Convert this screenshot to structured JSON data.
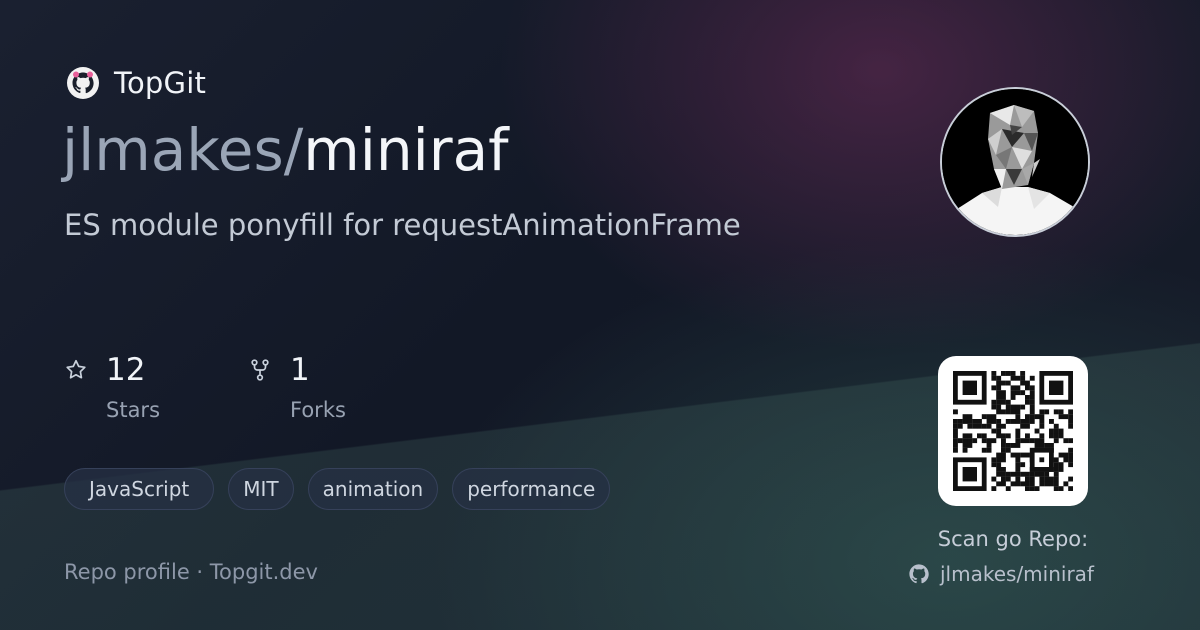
{
  "brand": {
    "name": "TopGit",
    "logo_icon": "github-octocat-icon"
  },
  "repo": {
    "owner": "jlmakes",
    "separator": "/",
    "name": "miniraf",
    "description": "ES module ponyfill for requestAnimationFrame"
  },
  "stats": [
    {
      "icon": "star-icon",
      "value": "12",
      "label": "Stars"
    },
    {
      "icon": "fork-icon",
      "value": "1",
      "label": "Forks"
    }
  ],
  "tags": [
    "JavaScript",
    "MIT",
    "animation",
    "performance"
  ],
  "footer": {
    "text": "Repo profile · Topgit.dev"
  },
  "qr": {
    "caption": "Scan go Repo:",
    "repo_link": "jlmakes/miniraf",
    "link_icon": "github-icon"
  },
  "colors": {
    "background": "#141a27",
    "accent_purple": "#6e2d5a",
    "accent_teal": "#2d5550",
    "text_primary": "#f1f4f8",
    "text_muted": "#98a2b2"
  }
}
